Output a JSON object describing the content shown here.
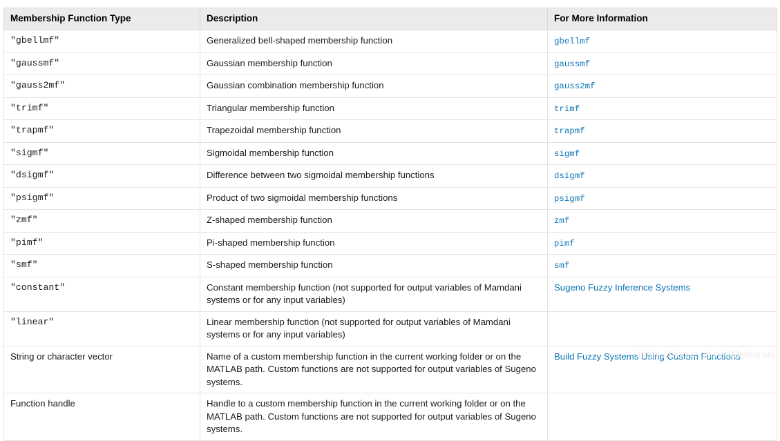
{
  "table": {
    "columns": [
      "Membership Function Type",
      "Description",
      "For More Information"
    ],
    "rows": [
      {
        "type": "\"gbellmf\"",
        "type_style": "code",
        "description": "Generalized bell-shaped membership function",
        "info": "gbellmf",
        "info_style": "code"
      },
      {
        "type": "\"gaussmf\"",
        "type_style": "code",
        "description": "Gaussian membership function",
        "info": "gaussmf",
        "info_style": "code"
      },
      {
        "type": "\"gauss2mf\"",
        "type_style": "code",
        "description": "Gaussian combination membership function",
        "info": "gauss2mf",
        "info_style": "code"
      },
      {
        "type": "\"trimf\"",
        "type_style": "code",
        "description": "Triangular membership function",
        "info": "trimf",
        "info_style": "code"
      },
      {
        "type": "\"trapmf\"",
        "type_style": "code",
        "description": "Trapezoidal membership function",
        "info": "trapmf",
        "info_style": "code"
      },
      {
        "type": "\"sigmf\"",
        "type_style": "code",
        "description": "Sigmoidal membership function",
        "info": "sigmf",
        "info_style": "code"
      },
      {
        "type": "\"dsigmf\"",
        "type_style": "code",
        "description": "Difference between two sigmoidal membership functions",
        "info": "dsigmf",
        "info_style": "code"
      },
      {
        "type": "\"psigmf\"",
        "type_style": "code",
        "description": "Product of two sigmoidal membership functions",
        "info": "psigmf",
        "info_style": "code"
      },
      {
        "type": "\"zmf\"",
        "type_style": "code",
        "description": "Z-shaped membership function",
        "info": "zmf",
        "info_style": "code"
      },
      {
        "type": "\"pimf\"",
        "type_style": "code",
        "description": "Pi-shaped membership function",
        "info": "pimf",
        "info_style": "code"
      },
      {
        "type": "\"smf\"",
        "type_style": "code",
        "description": "S-shaped membership function",
        "info": "smf",
        "info_style": "code"
      },
      {
        "type": "\"constant\"",
        "type_style": "code",
        "description": "Constant membership function (not supported for output variables of Mamdani systems or for any input variables)",
        "info": "Sugeno Fuzzy Inference Systems",
        "info_style": "text"
      },
      {
        "type": "\"linear\"",
        "type_style": "code",
        "description": "Linear membership function (not supported for output variables of Mamdani systems or for any input variables)",
        "info": "",
        "info_style": "text"
      },
      {
        "type": "String or character vector",
        "type_style": "text",
        "description": "Name of a custom membership function in the current working folder or on the MATLAB path. Custom functions are not supported for output variables of Sugeno systems.",
        "info": "Build Fuzzy Systems Using Custom Functions",
        "info_style": "text"
      },
      {
        "type": "Function handle",
        "type_style": "text",
        "description": "Handle to a custom membership function in the current working folder or on the MATLAB path. Custom functions are not supported for output variables of Sugeno systems.",
        "info": "",
        "info_style": "text"
      }
    ]
  },
  "watermark": {
    "text": "https://blog.csdn.net/Meteoraki"
  },
  "colors": {
    "link": "#0c75b5",
    "header_background": "#ebebeb",
    "border": "#e3e3e3",
    "watermark": "#ececec"
  }
}
